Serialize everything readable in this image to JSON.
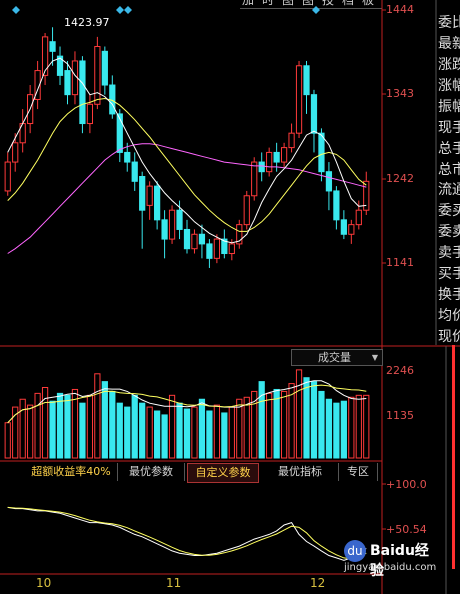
{
  "toolbar": {
    "items": [
      "加",
      "时",
      "图",
      "图",
      "技",
      "档",
      "板"
    ]
  },
  "price_axis": {
    "labels": [
      "1444",
      "1343",
      "1242",
      "1141"
    ]
  },
  "high_annotation": "1423.97",
  "volume_panel": {
    "title": "成交量",
    "axis": [
      "2246",
      "1135"
    ]
  },
  "tabs": [
    {
      "label": "超额收益率40%",
      "state": "active"
    },
    {
      "label": "最优参数",
      "state": "normal"
    },
    {
      "label": "自定义参数",
      "state": "selected"
    },
    {
      "label": "最优指标",
      "state": "normal"
    },
    {
      "label": "专区",
      "state": "normal"
    }
  ],
  "indicator_axis": [
    "+100.0",
    "+50.54"
  ],
  "dates": [
    "10",
    "11",
    "12"
  ],
  "side_panel": {
    "labels": [
      "委比",
      "最新",
      "涨跌",
      "涨幅",
      "振幅",
      "现手",
      "总手",
      "总市",
      "流通",
      "委买",
      "委卖",
      "卖手",
      "买手",
      "换手",
      "均价",
      "现价"
    ],
    "colors": [
      "#ff3030",
      "#ff3030",
      "#ff3030",
      "#ff3030",
      "#ff3030",
      "#ff3030",
      "#ff3030",
      "#ff3030",
      "#ff3030",
      "#ff3030",
      "#ff3030",
      "#ff3030",
      "#ff3030",
      "#ff3030",
      "#ff3030",
      "#ff3030",
      "#30ff30",
      "#ff3030",
      "#30ff30",
      "#30ff30",
      "#30ff30",
      "#ffffff"
    ]
  },
  "watermark": {
    "brand": "Baidu经验",
    "url": "jingyan.baidu.com"
  },
  "colors": {
    "up": "#ff3a3a",
    "down": "#39e8ee",
    "axis": "#c02020",
    "ma_short": "#ffffff",
    "ma_mid": "#ffff60",
    "ma_long": "#ff66ff"
  },
  "chart_data": {
    "type": "candlestick",
    "ylim": [
      1100,
      1450
    ],
    "candles": [
      [
        1260,
        1290,
        1255,
        1300
      ],
      [
        1290,
        1310,
        1280,
        1320
      ],
      [
        1310,
        1330,
        1300,
        1345
      ],
      [
        1330,
        1360,
        1320,
        1370
      ],
      [
        1355,
        1385,
        1345,
        1395
      ],
      [
        1380,
        1420,
        1370,
        1424
      ],
      [
        1415,
        1405,
        1390,
        1430
      ],
      [
        1400,
        1380,
        1370,
        1410
      ],
      [
        1385,
        1360,
        1350,
        1395
      ],
      [
        1360,
        1395,
        1350,
        1405
      ],
      [
        1395,
        1330,
        1320,
        1400
      ],
      [
        1330,
        1350,
        1320,
        1360
      ],
      [
        1350,
        1410,
        1345,
        1420
      ],
      [
        1405,
        1370,
        1360,
        1410
      ],
      [
        1370,
        1340,
        1335,
        1380
      ],
      [
        1340,
        1300,
        1290,
        1345
      ],
      [
        1300,
        1290,
        1280,
        1310
      ],
      [
        1290,
        1270,
        1260,
        1300
      ],
      [
        1275,
        1240,
        1200,
        1280
      ],
      [
        1245,
        1265,
        1230,
        1270
      ],
      [
        1265,
        1230,
        1220,
        1270
      ],
      [
        1230,
        1210,
        1190,
        1240
      ],
      [
        1210,
        1240,
        1205,
        1245
      ],
      [
        1240,
        1220,
        1210,
        1250
      ],
      [
        1220,
        1200,
        1195,
        1230
      ],
      [
        1200,
        1215,
        1195,
        1220
      ],
      [
        1215,
        1205,
        1190,
        1225
      ],
      [
        1205,
        1190,
        1180,
        1210
      ],
      [
        1190,
        1210,
        1185,
        1215
      ],
      [
        1210,
        1195,
        1190,
        1220
      ],
      [
        1195,
        1205,
        1188,
        1210
      ],
      [
        1205,
        1225,
        1200,
        1230
      ],
      [
        1225,
        1255,
        1220,
        1260
      ],
      [
        1255,
        1290,
        1250,
        1295
      ],
      [
        1290,
        1280,
        1270,
        1300
      ],
      [
        1280,
        1300,
        1275,
        1305
      ],
      [
        1300,
        1290,
        1280,
        1310
      ],
      [
        1290,
        1305,
        1285,
        1310
      ],
      [
        1305,
        1320,
        1300,
        1330
      ],
      [
        1320,
        1390,
        1315,
        1395
      ],
      [
        1390,
        1360,
        1340,
        1395
      ],
      [
        1360,
        1320,
        1300,
        1365
      ],
      [
        1320,
        1280,
        1270,
        1325
      ],
      [
        1280,
        1260,
        1240,
        1290
      ],
      [
        1260,
        1230,
        1220,
        1265
      ],
      [
        1230,
        1215,
        1210,
        1240
      ],
      [
        1215,
        1225,
        1205,
        1230
      ],
      [
        1225,
        1240,
        1220,
        1250
      ],
      [
        1240,
        1270,
        1235,
        1280
      ]
    ],
    "ma_short": [
      1300,
      1315,
      1330,
      1345,
      1365,
      1385,
      1395,
      1398,
      1392,
      1380,
      1372,
      1360,
      1362,
      1358,
      1350,
      1335,
      1320,
      1305,
      1290,
      1278,
      1268,
      1258,
      1250,
      1243,
      1236,
      1228,
      1222,
      1216,
      1212,
      1208,
      1206,
      1208,
      1215,
      1230,
      1248,
      1262,
      1275,
      1283,
      1292,
      1305,
      1318,
      1322,
      1318,
      1308,
      1290,
      1270,
      1252,
      1244,
      1245
    ],
    "ma_mid": [
      1250,
      1258,
      1268,
      1280,
      1292,
      1306,
      1320,
      1332,
      1340,
      1346,
      1350,
      1352,
      1355,
      1356,
      1354,
      1349,
      1342,
      1334,
      1325,
      1316,
      1306,
      1296,
      1286,
      1276,
      1266,
      1256,
      1248,
      1240,
      1233,
      1227,
      1222,
      1218,
      1218,
      1222,
      1228,
      1236,
      1246,
      1256,
      1266,
      1276,
      1286,
      1294,
      1298,
      1300,
      1298,
      1292,
      1282,
      1272,
      1266
    ],
    "ma_long": [
      1195,
      1200,
      1206,
      1212,
      1220,
      1228,
      1236,
      1244,
      1252,
      1260,
      1268,
      1276,
      1284,
      1292,
      1298,
      1303,
      1306,
      1308,
      1309,
      1309,
      1308,
      1306,
      1304,
      1302,
      1300,
      1298,
      1296,
      1294,
      1292,
      1290,
      1289,
      1288,
      1287,
      1286,
      1286,
      1285,
      1285,
      1284,
      1283,
      1282,
      1280,
      1278,
      1276,
      1274,
      1272,
      1270,
      1268,
      1266,
      1264
    ],
    "volume": [
      900,
      1300,
      1500,
      1350,
      1650,
      1800,
      1450,
      1650,
      1600,
      1750,
      1400,
      1600,
      2150,
      1950,
      1700,
      1400,
      1300,
      1600,
      1400,
      1300,
      1200,
      1100,
      1600,
      1400,
      1250,
      1300,
      1500,
      1200,
      1350,
      1150,
      1300,
      1500,
      1550,
      1700,
      1950,
      1650,
      1750,
      1700,
      1900,
      2250,
      2050,
      1950,
      1700,
      1500,
      1400,
      1450,
      1550,
      1600,
      1600
    ],
    "indicator": [
      85,
      84,
      84,
      83,
      82,
      82,
      81,
      80,
      78,
      76,
      74,
      72,
      72,
      71,
      70,
      68,
      65,
      62,
      60,
      57,
      54,
      51,
      48,
      46,
      45,
      44,
      44,
      45,
      46,
      48,
      50,
      52,
      55,
      58,
      60,
      62,
      65,
      70,
      72,
      62,
      56,
      52,
      48,
      44,
      42,
      40,
      42,
      46,
      50
    ],
    "indicator_ylim": [
      30,
      110
    ]
  }
}
